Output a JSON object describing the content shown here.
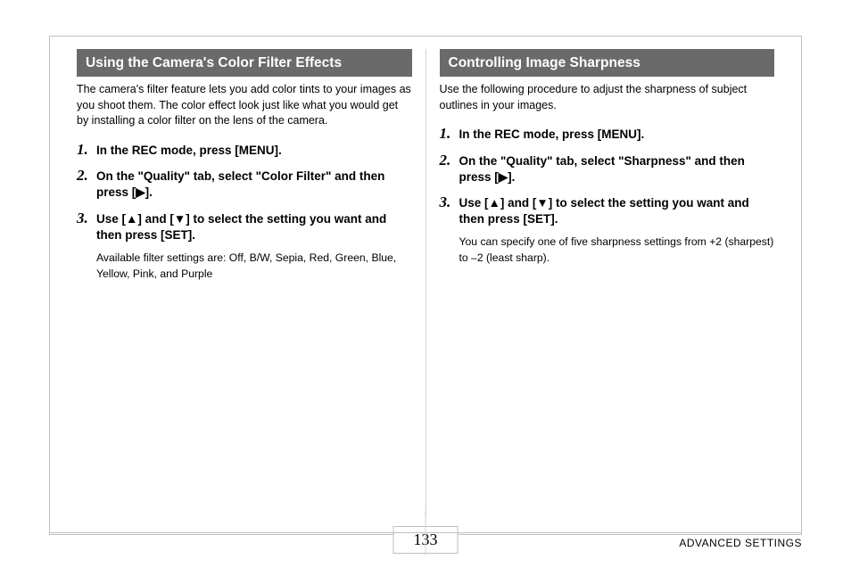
{
  "page_number": "133",
  "footer": "ADVANCED SETTINGS",
  "left": {
    "heading": "Using the Camera's Color Filter Effects",
    "intro": "The camera's filter feature lets you add color tints to your images as you shoot them. The color effect look just like what you would get by installing a color filter on the lens of the camera.",
    "steps": [
      {
        "n": "1.",
        "text": "In the REC mode, press [MENU]."
      },
      {
        "n": "2.",
        "text": "On the \"Quality\" tab, select \"Color Filter\" and then press [▶]."
      },
      {
        "n": "3.",
        "text": "Use [▲] and [▼] to select the setting you want and then press [SET].",
        "note": "Available filter settings are: Off, B/W, Sepia, Red, Green, Blue, Yellow, Pink, and Purple"
      }
    ]
  },
  "right": {
    "heading": "Controlling Image Sharpness",
    "intro": "Use the following procedure to adjust the sharpness of subject outlines in your images.",
    "steps": [
      {
        "n": "1.",
        "text": "In the REC mode, press [MENU]."
      },
      {
        "n": "2.",
        "text": "On the \"Quality\" tab, select \"Sharpness\" and then press [▶]."
      },
      {
        "n": "3.",
        "text": "Use [▲] and [▼] to select the setting you want and then press [SET].",
        "note": "You can specify one of five sharpness settings from +2 (sharpest) to –2 (least sharp)."
      }
    ]
  }
}
